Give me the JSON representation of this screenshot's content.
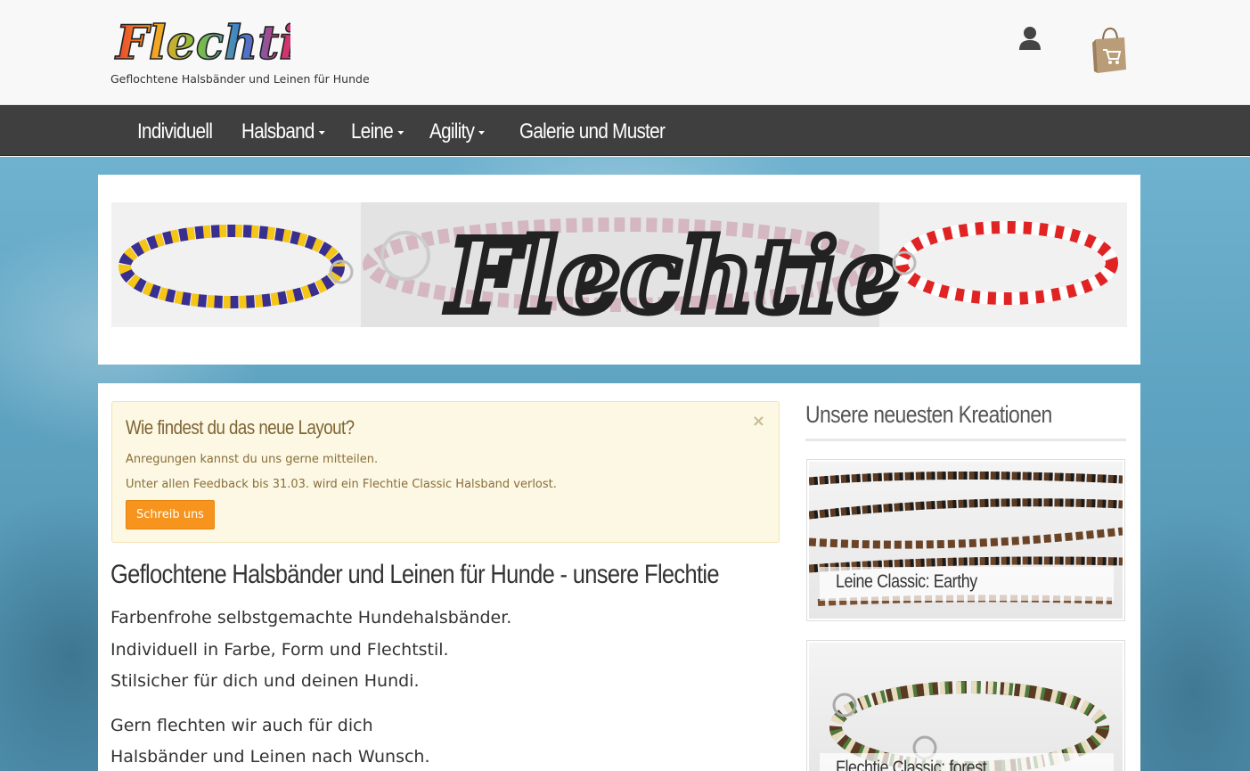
{
  "brand": {
    "logo_text": "Flechtie",
    "tagline": "Geflochtene Halsbänder und Leinen für Hunde"
  },
  "header": {
    "user_icon": "user-icon",
    "cart_icon": "shopping-bag-cart-icon"
  },
  "nav": {
    "items": [
      {
        "label": "Individuell",
        "dropdown": false
      },
      {
        "label": "Halsband",
        "dropdown": true
      },
      {
        "label": "Leine",
        "dropdown": true
      },
      {
        "label": "Agility",
        "dropdown": true
      },
      {
        "label": "Galerie und Muster",
        "dropdown": false
      }
    ]
  },
  "banner": {
    "logo_text": "Flechtie"
  },
  "alert": {
    "title": "Wie findest du das neue Layout?",
    "line1": "Anregungen kannst du uns gerne mitteilen.",
    "line2": "Unter allen Feedback bis 31.03. wird ein Flechtie Classic Halsband verlost.",
    "button": "Schreib uns",
    "close": "×"
  },
  "main": {
    "heading": "Geflochtene Halsbänder und Leinen für Hunde - unsere Flechtie",
    "paragraphs": [
      "Farbenfrohe selbstgemachte Hundehalsbänder.",
      "Individuell in Farbe, Form und Flechtstil.",
      "Stilsicher für dich und deinen Hundi.",
      "Gern flechten wir auch für dich",
      "Halsbänder und Leinen nach Wunsch."
    ]
  },
  "sidebar": {
    "title": "Unsere neuesten Kreationen",
    "cards": [
      {
        "label": "Leine Classic: Earthy"
      },
      {
        "label": "Flechtie Classic: forest"
      }
    ]
  },
  "colors": {
    "nav_bg": "#3f3f3f",
    "accent_button": "#f7941d",
    "alert_bg": "#fcf8e3",
    "alert_text": "#8a6d3b",
    "page_bg_blue": "#5ea3c1"
  }
}
